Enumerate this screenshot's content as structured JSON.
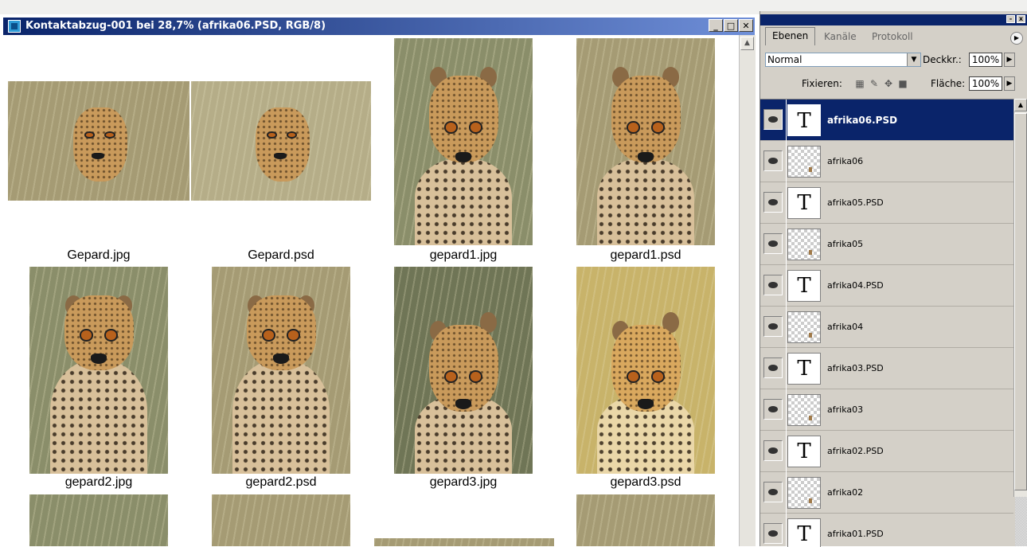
{
  "document": {
    "title": "Kontaktabzug-001 bei 28,7% (afrika06.PSD, RGB/8)",
    "captions": [
      "Gepard.jpg",
      "Gepard.psd",
      "gepard1.jpg",
      "gepard1.psd",
      "gepard2.jpg",
      "gepard2.psd",
      "gepard3.jpg",
      "gepard3.psd"
    ],
    "window_buttons": {
      "minimize": "_",
      "maximize": "□",
      "close": "✕"
    }
  },
  "panel": {
    "tabs": [
      "Ebenen",
      "Kanäle",
      "Protokoll"
    ],
    "blend_mode": "Normal",
    "opacity_label": "Deckkr.:",
    "opacity_value": "100%",
    "lock_label": "Fixieren:",
    "fill_label": "Fläche:",
    "fill_value": "100%",
    "layers": [
      {
        "name": "afrika06.PSD",
        "type": "text",
        "selected": true
      },
      {
        "name": "afrika06",
        "type": "image"
      },
      {
        "name": "afrika05.PSD",
        "type": "text"
      },
      {
        "name": "afrika05",
        "type": "image"
      },
      {
        "name": "afrika04.PSD",
        "type": "text"
      },
      {
        "name": "afrika04",
        "type": "image"
      },
      {
        "name": "afrika03.PSD",
        "type": "text"
      },
      {
        "name": "afrika03",
        "type": "image"
      },
      {
        "name": "afrika02.PSD",
        "type": "text"
      },
      {
        "name": "afrika02",
        "type": "image"
      },
      {
        "name": "afrika01.PSD",
        "type": "text"
      }
    ],
    "text_layer_glyph": "T"
  },
  "colors": {
    "title_bar": "#0a246a",
    "selected_layer": "#0a246a",
    "panel_bg": "#d4d0c8"
  }
}
